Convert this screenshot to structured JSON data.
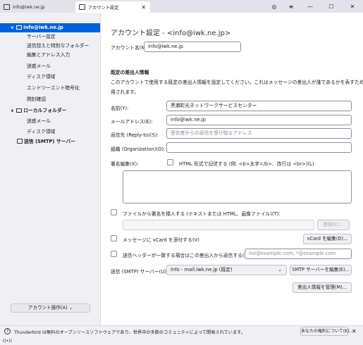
{
  "tabs": [
    {
      "label": "info@iwk.ne.jp",
      "icon": "mail-tab-icon"
    },
    {
      "label": "アカウント設定",
      "icon": "settings-tab-icon",
      "close": "✕"
    }
  ],
  "window_controls": {
    "menu": "≡",
    "minimize": "—",
    "maximize": "☐",
    "close": "✕",
    "activity": "◎"
  },
  "sidebar": {
    "account": "info@iwk.ne.jp",
    "items": [
      "サーバー設定",
      "送信控えと特別なフォルダー",
      "編集とアドレス入力",
      "迷惑メール",
      "ディスク領域",
      "エンドツーエンド暗号化",
      "開封確認"
    ],
    "local_folders": "ローカルフォルダー",
    "local_items": [
      "迷惑メール",
      "ディスク領域"
    ],
    "smtp": "送信 (SMTP) サーバー",
    "account_actions": "アカウント操作(A)",
    "account_actions_arrow": "⌄"
  },
  "main": {
    "heading": "アカウント設定 - <info@iwk.ne.jp>",
    "account_name_label": "アカウント名(N):",
    "account_name_value": "info@iwk.ne.jp",
    "identity_title": "既定の差出人情報",
    "identity_desc_1": "このアカウントで使用する既定の差出人情報を設定してください。これはメッセージの差出人が誰であるかを表すために使",
    "identity_desc_2": "用されます。",
    "name_label": "名前(Y):",
    "name_value": "黒瀬町光ネットワークサービスセンター",
    "email_label": "メールアドレス(E):",
    "email_value": "info@iwk.ne.jp",
    "replyto_label": "返信先 (Reply-to)(S):",
    "replyto_placeholder": "受信者からの返信を受け取るアドレス",
    "org_label": "組織 (Organization)(O):",
    "org_value": "",
    "sig_label": "署名編集(X):",
    "html_check_label": "HTML 形式で記述する (例: <b>太字</b>、改行は <br>)(L)",
    "file_sig_label": "ファイルから署名を挿入する (テキストまたは HTML、画像ファイル)(T):",
    "browse_label": "参照(C)...",
    "vcard_label": "メッセージに vCard を添付する(V)",
    "vcard_edit": "vCard を編集(D)...",
    "reply_header_label": "送信ヘッダーが一致する場合はこの差出人から返信する(D):",
    "reply_header_placeholder": "list@example.com, *@example.com",
    "smtp_label": "送信 (SMTP) サーバー(U):",
    "smtp_value": "info - mail.iwk.ne.jp (既定)",
    "smtp_arrow": "⌄",
    "smtp_edit": "SMTP サーバーを編集(E)...",
    "manage_identities": "差出人情報を管理(M)..."
  },
  "status": {
    "message": "Thunderbird は無料のオープンソースソフトウェアであり、世界中の多数のコミュニティによって開発されています。",
    "rights": "あなたの権利について(K)...",
    "close": "✕",
    "help_icon": "?",
    "activity": "((•))"
  }
}
